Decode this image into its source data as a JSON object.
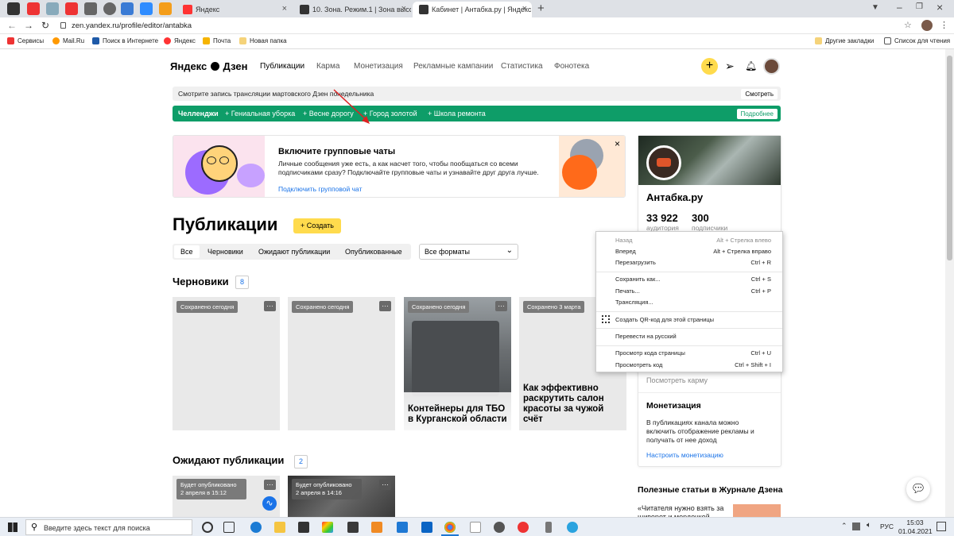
{
  "browser": {
    "tabs": [
      {
        "label": "Яндекс",
        "active": false
      },
      {
        "label": "10. Зона. Режим.1 | Зона высок",
        "active": false
      },
      {
        "label": "Кабинет | Антабка.ру | Яндекс Д",
        "active": true
      }
    ],
    "new_tab": "+",
    "address": "zen.yandex.ru/profile/editor/antabka",
    "bookmarks": [
      "Сервисы",
      "Mail.Ru",
      "Поиск в Интернете",
      "Яндекс",
      "Почта",
      "Новая папка"
    ],
    "bookmarks_right": [
      "Другие закладки",
      "Список для чтения"
    ]
  },
  "header": {
    "logo": "Яндекс",
    "logo2": "Дзен",
    "nav": [
      "Публикации",
      "Карма",
      "Монетизация",
      "Рекламные кампании",
      "Статистика",
      "Фонотека"
    ]
  },
  "notice": {
    "text": "Смотрите запись трансляции мартовского Дзен понедельника",
    "button": "Смотреть"
  },
  "challenges": {
    "title": "Челленджи",
    "items": [
      "+ Гениальная уборка",
      "+ Весне дорогу",
      "+ Город золотой",
      "+ Школа ремонта"
    ],
    "more": "Подробнее"
  },
  "promo": {
    "title": "Включите групповые чаты",
    "text1": "Личные сообщения уже есть, а как насчет того, чтобы пообщаться со всеми",
    "text2": "подписчиками сразу? Подключайте групповые чаты и узнавайте друг друга лучше.",
    "link": "Подключить групповой чат",
    "close": "×"
  },
  "publications": {
    "title": "Публикации",
    "create": "+ Создать",
    "filters": [
      "Все",
      "Черновики",
      "Ожидают публикации",
      "Опубликованные"
    ],
    "format": "Все форматы"
  },
  "drafts": {
    "title": "Черновики",
    "count": "8",
    "cards": [
      {
        "badge": "Сохранено сегодня",
        "title": ""
      },
      {
        "badge": "Сохранено сегодня",
        "title": ""
      },
      {
        "badge": "Сохранено сегодня",
        "title": "Контейнеры для ТБО в Курганской области"
      },
      {
        "badge": "Сохранено 3 марта",
        "title": "Как эффективно раскрутить салон красоты за чужой счёт"
      }
    ]
  },
  "pending": {
    "title": "Ожидают публикации",
    "count": "2",
    "cards": [
      {
        "badge1": "Будет опубликовано",
        "badge2": "2 апреля в 15:12"
      },
      {
        "badge1": "Будет опубликовано",
        "badge2": "2 апреля в 14:16"
      }
    ]
  },
  "profile": {
    "name": "Антабка.ру",
    "audience": "33 922",
    "audience_label": "аудитория",
    "subs": "300",
    "subs_label": "подписчики",
    "karma_link": "Посмотреть карму",
    "monet_title": "Монетизация",
    "monet_text1": "В публикациях канала можно",
    "monet_text2": "включить отображение рекламы и",
    "monet_text3": "получать от нее доход",
    "monet_link": "Настроить монетизацию",
    "articles_title": "Полезные статьи в Журнале Дзена",
    "article1": "«Читателя нужно взять за",
    "article2": "шиворот и мордочкой"
  },
  "context_menu": {
    "items": [
      {
        "label": "Назад",
        "shortcut": "Alt + Стрелка влево",
        "disabled": true
      },
      {
        "label": "Вперед",
        "shortcut": "Alt + Стрелка вправо",
        "disabled": false
      },
      {
        "label": "Перезагрузить",
        "shortcut": "Ctrl + R",
        "disabled": false
      },
      {
        "label": "Сохранить как...",
        "shortcut": "Ctrl + S",
        "disabled": false
      },
      {
        "label": "Печать...",
        "shortcut": "Ctrl + P",
        "disabled": false
      },
      {
        "label": "Трансляция...",
        "shortcut": "",
        "disabled": false
      },
      {
        "label": "Создать QR-код для этой страницы",
        "shortcut": "",
        "disabled": false
      },
      {
        "label": "Перевести на русский",
        "shortcut": "",
        "disabled": false
      },
      {
        "label": "Просмотр кода страницы",
        "shortcut": "Ctrl + U",
        "disabled": false
      },
      {
        "label": "Просмотреть код",
        "shortcut": "Ctrl + Shift + I",
        "disabled": false
      }
    ]
  },
  "taskbar": {
    "search": "Введите здесь текст для поиска",
    "lang": "РУС",
    "time": "15:03",
    "date": "01.04.2021"
  },
  "colors": {
    "accent_yellow": "#ffdb4d",
    "green": "#0e9d68",
    "link": "#1a73e8"
  }
}
